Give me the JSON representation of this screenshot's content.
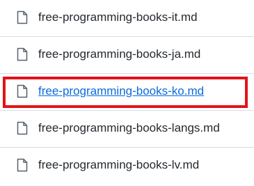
{
  "file_list": {
    "items": [
      {
        "name": "free-programming-books-it.md",
        "icon": "file-icon",
        "active": false
      },
      {
        "name": "free-programming-books-ja.md",
        "icon": "file-icon",
        "active": false
      },
      {
        "name": "free-programming-books-ko.md",
        "icon": "file-icon",
        "active": true
      },
      {
        "name": "free-programming-books-langs.md",
        "icon": "file-icon",
        "active": false
      },
      {
        "name": "free-programming-books-lv.md",
        "icon": "file-icon",
        "active": false
      }
    ]
  },
  "colors": {
    "text": "#24292f",
    "link": "#0969da",
    "highlight": "#e3131a",
    "divider": "#d8dee4",
    "icon": "#57606a"
  }
}
